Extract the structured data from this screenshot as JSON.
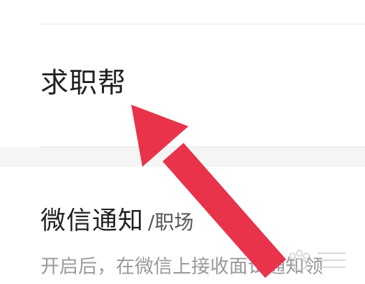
{
  "menu": {
    "item_title": "求职帮"
  },
  "notification": {
    "title": "微信通知",
    "subtitle": "/职场",
    "description": "开启后，在微信上接收面试通知领"
  },
  "colors": {
    "arrow": "#e8334a",
    "title_text": "#222222",
    "desc_text": "#999999",
    "divider": "#e6e6e6",
    "section_gap": "#f5f5f5"
  },
  "icons": {
    "arrow": "red-arrow-icon",
    "watermark": "baidu-jingyan-watermark"
  }
}
